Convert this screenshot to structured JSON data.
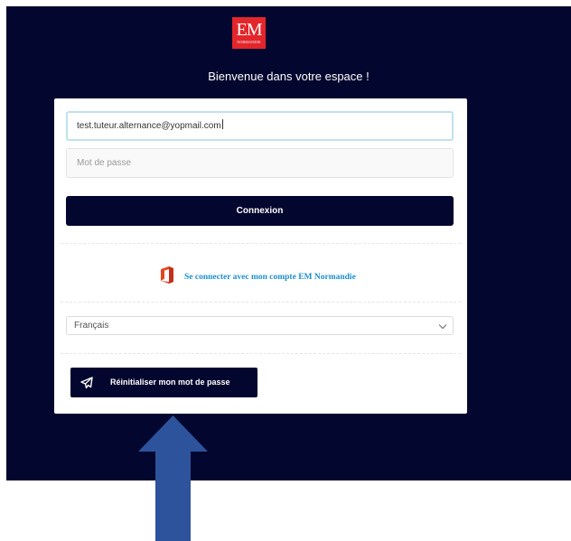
{
  "brand": {
    "logo_monogram": "EM",
    "logo_subtitle": "NORMANDIE",
    "logo_color": "#e3262b"
  },
  "colors": {
    "background_navy": "#03062e",
    "link_blue": "#1c8fd0",
    "annotation_arrow": "#2c539b"
  },
  "welcome_text": "Bienvenue dans votre espace !",
  "login_form": {
    "email_value": "test.tuteur.alternance@yopmail.com",
    "password_placeholder": "Mot de passe",
    "submit_label": "Connexion",
    "microsoft_icon": "office-icon",
    "microsoft_link": "Se connecter avec mon compte EM Normandie",
    "language_selected": "Français",
    "reset_icon": "paper-plane-icon",
    "reset_label": "Réinitialiser mon mot de passe"
  },
  "annotation": {
    "arrow_icon": "arrow-up-icon"
  }
}
